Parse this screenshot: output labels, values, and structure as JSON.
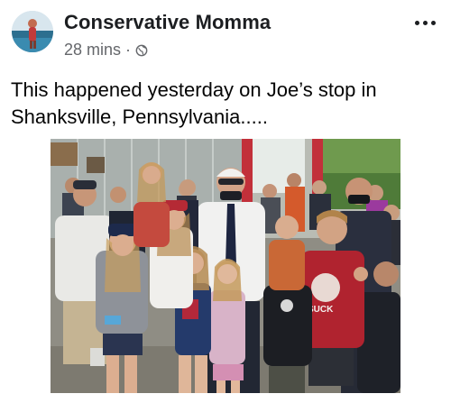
{
  "post": {
    "author": "Conservative Momma",
    "timestamp": "28 mins",
    "separator": "·",
    "privacy_icon": "globe-icon",
    "more_icon": "more-options-icon",
    "caption": "This happened yesterday on Joe’s stop in Shanksville, Pennsylvania.....",
    "photo_text": "SUCK"
  },
  "colors": {
    "author_text": "#1c1e21",
    "meta_text": "#65676b",
    "background": "#ffffff"
  }
}
